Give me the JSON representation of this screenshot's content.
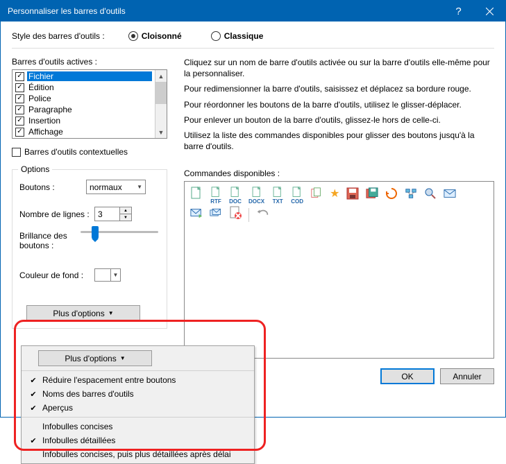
{
  "titlebar": {
    "title": "Personnaliser les barres d'outils",
    "help_label": "?",
    "close_label": "×"
  },
  "style_row": {
    "label": "Style des barres d'outils :",
    "option_a": "Cloisonné",
    "option_b": "Classique"
  },
  "active_toolbars": {
    "label": "Barres d'outils actives :",
    "items": [
      {
        "label": "Fichier",
        "checked": true,
        "selected": true
      },
      {
        "label": "Édition",
        "checked": true,
        "selected": false
      },
      {
        "label": "Police",
        "checked": true,
        "selected": false
      },
      {
        "label": "Paragraphe",
        "checked": true,
        "selected": false
      },
      {
        "label": "Insertion",
        "checked": true,
        "selected": false
      },
      {
        "label": "Affichage",
        "checked": true,
        "selected": false
      }
    ]
  },
  "contextual": {
    "label": "Barres d'outils contextuelles",
    "checked": false
  },
  "options": {
    "legend": "Options",
    "buttons_label": "Boutons :",
    "buttons_value": "normaux",
    "lines_label": "Nombre de lignes :",
    "lines_value": "3",
    "brightness_label": "Brillance des boutons :",
    "bg_label": "Couleur de fond :"
  },
  "more_options": {
    "label": "Plus d'options"
  },
  "help_text": {
    "p1": "Cliquez sur un nom de barre d'outils activée ou sur la barre d'outils elle-même pour la personnaliser.",
    "p2": "Pour redimensionner la barre d'outils, saisissez et déplacez sa bordure rouge.",
    "p3": "Pour réordonner les boutons de la barre d'outils, utilisez le glisser-déplacer.",
    "p4": "Pour enlever un bouton de la barre d'outils, glissez-le hors de celle-ci.",
    "p5": "Utilisez la liste des commandes disponibles pour glisser des boutons jusqu'à la barre d'outils."
  },
  "commands": {
    "label": "Commandes disponibles :",
    "doc_exts": [
      "RTF",
      "DOC",
      "DOCX",
      "TXT",
      "COD"
    ]
  },
  "footer": {
    "ok": "OK",
    "cancel": "Annuler"
  },
  "popup": {
    "items1": [
      {
        "checked": true,
        "label": "Réduire l'espacement entre boutons"
      },
      {
        "checked": true,
        "label": "Noms des barres d'outils"
      },
      {
        "checked": true,
        "label": "Aperçus"
      }
    ],
    "items2": [
      {
        "checked": false,
        "label": "Infobulles concises"
      },
      {
        "checked": true,
        "label": "Infobulles détaillées"
      },
      {
        "checked": false,
        "label": "Infobulles concises, puis plus détaillées après délai"
      }
    ]
  }
}
